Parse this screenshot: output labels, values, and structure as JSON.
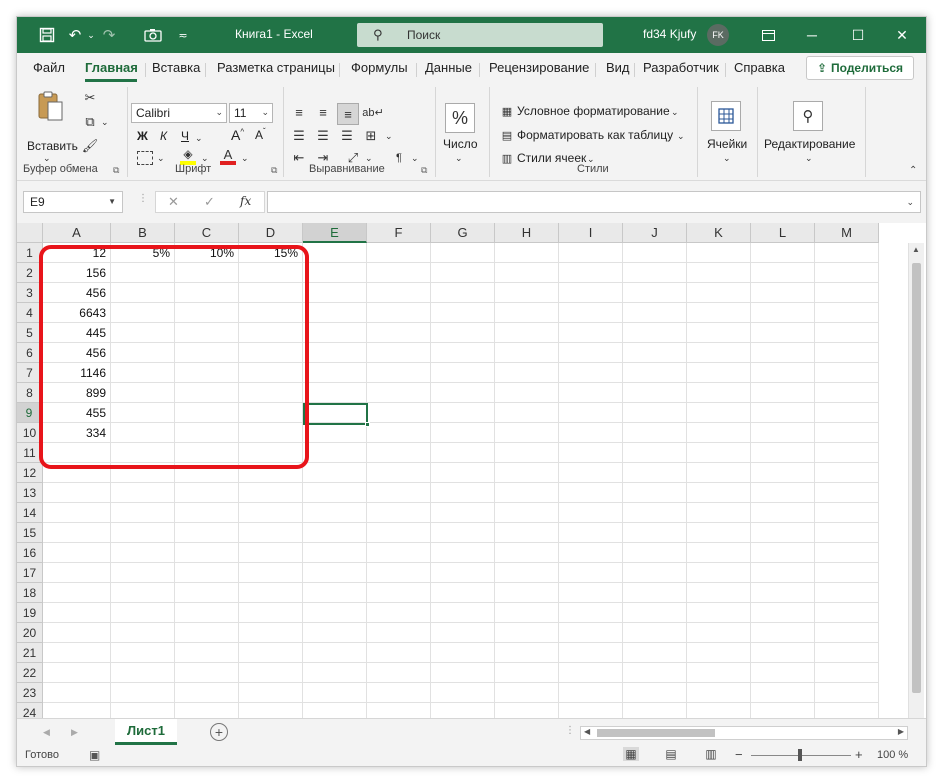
{
  "titlebar": {
    "doc_title": "Книга1  -  Excel",
    "search_placeholder": "Поиск",
    "user_name": "fd34 Kjufy",
    "avatar_initials": "FK",
    "accent_color": "#217346"
  },
  "tabs": [
    "Файл",
    "Главная",
    "Вставка",
    "Разметка страницы",
    "Формулы",
    "Данные",
    "Рецензирование",
    "Вид",
    "Разработчик",
    "Справка"
  ],
  "active_tab": "Главная",
  "share_label": "Поделиться",
  "ribbon": {
    "clipboard": {
      "paste_label": "Вставить",
      "group_label": "Буфер обмена"
    },
    "font": {
      "font_name": "Calibri",
      "font_size": "11",
      "bold": "Ж",
      "italic": "К",
      "underline": "Ч",
      "group_label": "Шрифт"
    },
    "alignment": {
      "group_label": "Выравнивание"
    },
    "number": {
      "label": "Число"
    },
    "styles": {
      "conditional": "Условное форматирование",
      "format_table": "Форматировать как таблицу",
      "cell_styles": "Стили ячеек",
      "group_label": "Стили"
    },
    "cells": {
      "label": "Ячейки"
    },
    "editing": {
      "label": "Редактирование"
    }
  },
  "formula_bar": {
    "name_box": "E9",
    "fx": "fx",
    "value": ""
  },
  "grid": {
    "columns": [
      "A",
      "B",
      "C",
      "D",
      "E",
      "F",
      "G",
      "H",
      "I",
      "J",
      "K",
      "L",
      "M"
    ],
    "selected_column": "E",
    "selected_row": "9",
    "active_cell": "E9",
    "rows": [
      {
        "n": "1",
        "A": "12",
        "B": "5%",
        "C": "10%",
        "D": "15%"
      },
      {
        "n": "2",
        "A": "156"
      },
      {
        "n": "3",
        "A": "456"
      },
      {
        "n": "4",
        "A": "6643"
      },
      {
        "n": "5",
        "A": "445"
      },
      {
        "n": "6",
        "A": "456"
      },
      {
        "n": "7",
        "A": "1146"
      },
      {
        "n": "8",
        "A": "899"
      },
      {
        "n": "9",
        "A": "455"
      },
      {
        "n": "10",
        "A": "334"
      },
      {
        "n": "11"
      },
      {
        "n": "12"
      },
      {
        "n": "13"
      },
      {
        "n": "14"
      },
      {
        "n": "15"
      },
      {
        "n": "16"
      },
      {
        "n": "17"
      },
      {
        "n": "18"
      },
      {
        "n": "19"
      },
      {
        "n": "20"
      },
      {
        "n": "21"
      },
      {
        "n": "22"
      },
      {
        "n": "23"
      },
      {
        "n": "24"
      }
    ],
    "highlight_color": "#e8141a"
  },
  "sheets": {
    "tabs": [
      "Лист1"
    ],
    "active": "Лист1"
  },
  "statusbar": {
    "ready": "Готово",
    "zoom": "100 %"
  }
}
